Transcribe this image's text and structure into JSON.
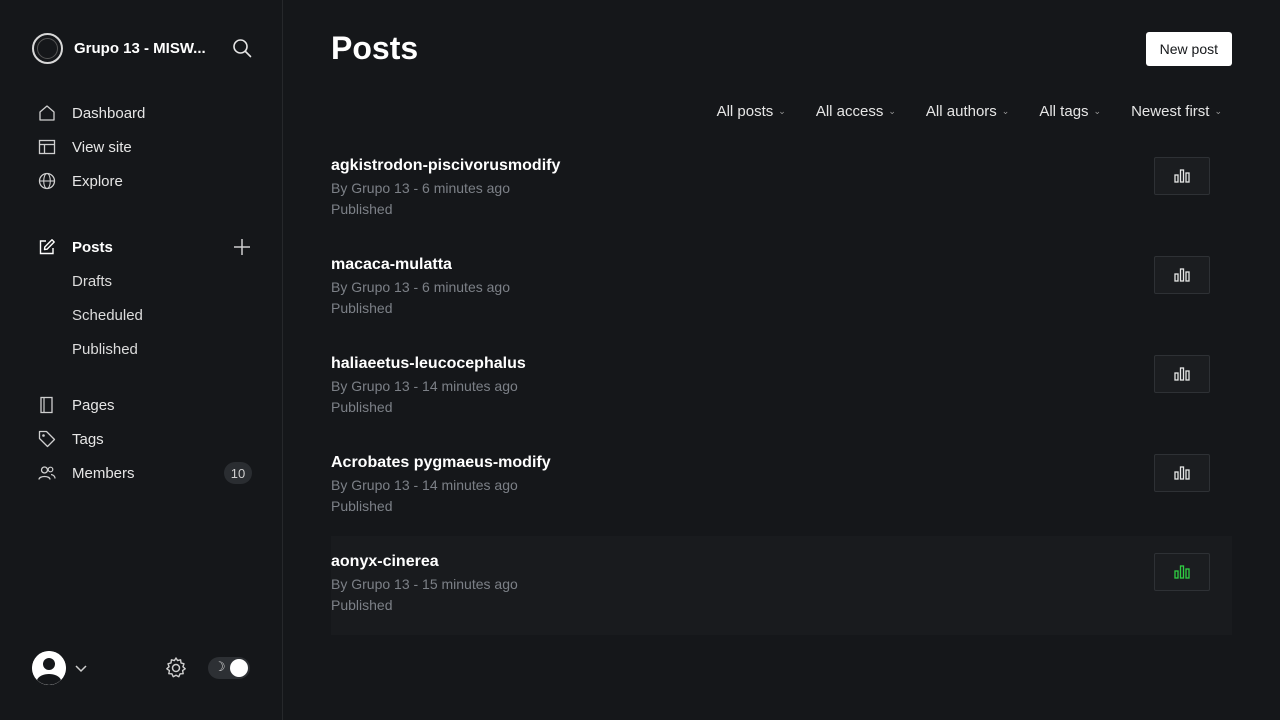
{
  "brand": {
    "name": "Grupo 13 - MISW..."
  },
  "nav": {
    "main": [
      {
        "label": "Dashboard",
        "icon": "house-icon"
      },
      {
        "label": "View site",
        "icon": "layout-icon"
      },
      {
        "label": "Explore",
        "icon": "globe-icon"
      }
    ],
    "posts": {
      "label": "Posts",
      "icon": "pencil-square-icon"
    },
    "post_subitems": [
      "Drafts",
      "Scheduled",
      "Published"
    ],
    "secondary": [
      {
        "label": "Pages",
        "icon": "page-icon"
      },
      {
        "label": "Tags",
        "icon": "tag-icon"
      },
      {
        "label": "Members",
        "icon": "people-icon",
        "badge": "10"
      }
    ]
  },
  "header": {
    "title": "Posts",
    "new_post_label": "New post"
  },
  "filters": [
    "All posts",
    "All access",
    "All authors",
    "All tags",
    "Newest first"
  ],
  "posts": [
    {
      "title": "agkistrodon-piscivorusmodify",
      "meta": "By Grupo 13 - 6 minutes ago",
      "status": "Published"
    },
    {
      "title": "macaca-mulatta",
      "meta": "By Grupo 13 - 6 minutes ago",
      "status": "Published"
    },
    {
      "title": "haliaeetus-leucocephalus",
      "meta": "By Grupo 13 - 14 minutes ago",
      "status": "Published"
    },
    {
      "title": "Acrobates pygmaeus-modify",
      "meta": "By Grupo 13 - 14 minutes ago",
      "status": "Published"
    },
    {
      "title": "aonyx-cinerea",
      "meta": "By Grupo 13 - 15 minutes ago",
      "status": "Published"
    }
  ],
  "colors": {
    "background": "#15171a",
    "stats_icon": "#ffffff",
    "stats_icon_hover": "#30cf43",
    "muted_text": "#7c8087"
  }
}
